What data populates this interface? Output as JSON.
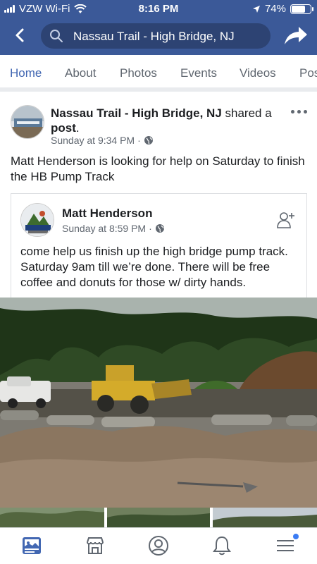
{
  "status_bar": {
    "carrier": "VZW Wi-Fi",
    "time": "8:16 PM",
    "battery": "74%",
    "battery_level": 0.74,
    "icons": [
      "signal-icon",
      "wifi-icon",
      "location-arrow-icon",
      "battery-icon"
    ]
  },
  "search": {
    "text": "Nassau Trail - High Bridge, NJ"
  },
  "tabs": [
    {
      "label": "Home",
      "active": true
    },
    {
      "label": "About"
    },
    {
      "label": "Photos"
    },
    {
      "label": "Events"
    },
    {
      "label": "Videos"
    },
    {
      "label": "Pos"
    }
  ],
  "post": {
    "page_name": "Nassau Trail - High Bridge, NJ",
    "action_text": " shared a ",
    "action_object": "post",
    "action_suffix": ".",
    "time": "Sunday at 9:34 PM",
    "separator": "·",
    "text": "Matt Henderson is looking for help on Saturday to finish the HB Pump Track",
    "shared": {
      "name": "Matt Henderson",
      "time": "Sunday at 8:59 PM",
      "separator": "·",
      "text": "come help us finish up the high bridge pump track.  Saturday 9am till we’re done. There will be free coffee and donuts for those w/ dirty hands."
    }
  },
  "colors": {
    "brand": "#3b5998",
    "search_bg": "#2d4373",
    "tab_active": "#4267b2",
    "muted": "#606770",
    "notification": "#3b7cf4"
  },
  "bottom_nav": [
    "news-feed-icon",
    "marketplace-icon",
    "profile-icon",
    "notifications-icon",
    "menu-icon"
  ]
}
